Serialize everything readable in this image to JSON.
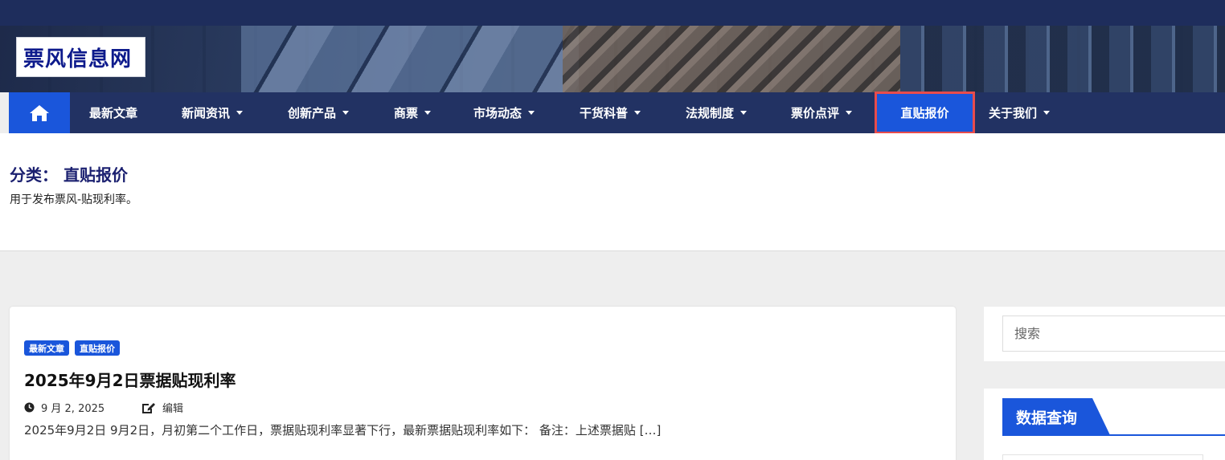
{
  "site": {
    "logo": "票风信息网"
  },
  "nav": {
    "home_icon": "home-icon",
    "items": [
      {
        "label": "最新文章",
        "has_caret": false
      },
      {
        "label": "新闻资讯",
        "has_caret": true
      },
      {
        "label": "创新产品",
        "has_caret": true
      },
      {
        "label": "商票",
        "has_caret": true
      },
      {
        "label": "市场动态",
        "has_caret": true
      },
      {
        "label": "干货科普",
        "has_caret": true
      },
      {
        "label": "法规制度",
        "has_caret": true
      },
      {
        "label": "票价点评",
        "has_caret": true
      },
      {
        "label": "直贴报价",
        "has_caret": false,
        "active": true
      },
      {
        "label": "关于我们",
        "has_caret": true
      }
    ]
  },
  "category": {
    "title": "分类： 直贴报价",
    "description": "用于发布票风-贴现利率。"
  },
  "post": {
    "tags": [
      "最新文章",
      "直贴报价"
    ],
    "title": "2025年9月2日票据贴现利率",
    "date": "9 月 2, 2025",
    "edit_label": "编辑",
    "excerpt": "2025年9月2日 9月2日，月初第二个工作日，票据贴现利率显著下行，最新票据贴现利率如下： 备注：上述票据贴 […]"
  },
  "sidebar": {
    "search_placeholder": "搜索",
    "widget_title": "数据查询"
  },
  "colors": {
    "topbar": "#1e2d5c",
    "nav_bg": "#223263",
    "accent": "#1a56db",
    "active_border": "#e84c4c",
    "title": "#1b2070"
  }
}
